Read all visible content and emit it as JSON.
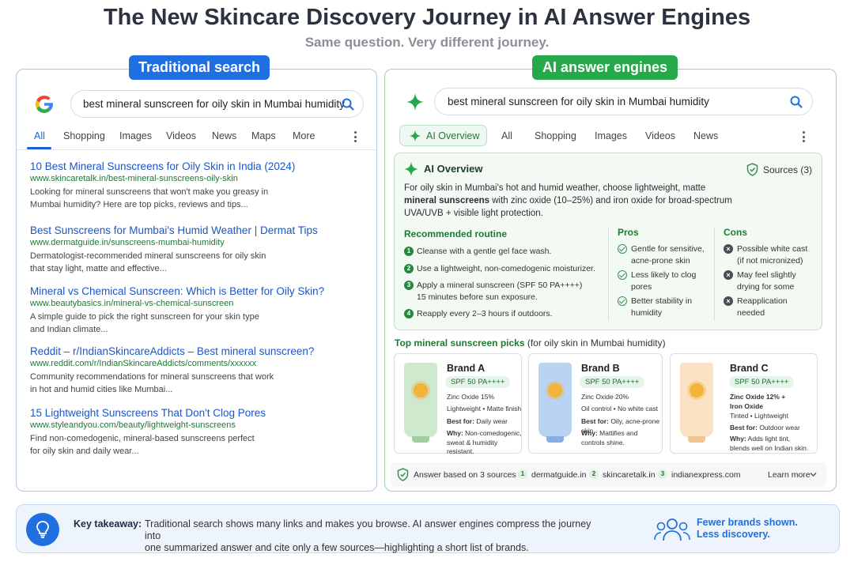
{
  "header": {
    "title": "The New Skincare Discovery Journey in AI Answer Engines",
    "subtitle": "Same question. Very different journey."
  },
  "traditional": {
    "label": "Traditional search",
    "query": "best mineral sunscreen for oily skin in Mumbai humidity",
    "tabs": [
      "All",
      "Shopping",
      "Images",
      "Videos",
      "News",
      "Maps",
      "More"
    ],
    "results": [
      {
        "title": "10 Best Mineral Sunscreens for Oily Skin in India (2024)",
        "url": "www.skincaretalk.in/best-mineral-sunscreens-oily-skin",
        "desc1": "Looking for mineral sunscreens that won't make you greasy in",
        "desc2": "Mumbai humidity? Here are top picks, reviews and tips..."
      },
      {
        "title": "Best Sunscreens for Mumbai's Humid Weather | Dermat Tips",
        "url": "www.dermatguide.in/sunscreens-mumbai-humidity",
        "desc1": "Dermatologist-recommended mineral sunscreens for oily skin",
        "desc2": "that stay light, matte and effective..."
      },
      {
        "title": "Mineral vs Chemical Sunscreen: Which is Better for Oily Skin?",
        "url": "www.beautybasics.in/mineral-vs-chemical-sunscreen",
        "desc1": "A simple guide to pick the right sunscreen for your skin type",
        "desc2": "and Indian climate..."
      },
      {
        "title": "Reddit – r/IndianSkincareAddicts – Best mineral sunscreen?",
        "url": "www.reddit.com/r/IndianSkincareAddicts/comments/xxxxxx",
        "desc1": "Community recommendations for mineral sunscreens that work",
        "desc2": "in hot and humid cities like Mumbai..."
      },
      {
        "title": "15 Lightweight Sunscreens That Don't Clog Pores",
        "url": "www.styleandyou.com/beauty/lightweight-sunscreens",
        "desc1": "Find non-comedogenic, mineral-based sunscreens perfect",
        "desc2": "for oily skin and daily wear..."
      }
    ]
  },
  "ai": {
    "label": "AI answer engines",
    "query": "best mineral sunscreen for oily skin in Mumbai humidity",
    "tabs": [
      "AI Overview",
      "All",
      "Shopping",
      "Images",
      "Videos",
      "News"
    ],
    "overview": {
      "heading": "AI Overview",
      "sources": "Sources (3)",
      "line1": "For oily skin in Mumbai's hot and humid weather, choose lightweight, matte",
      "line2_bold": "mineral sunscreens",
      "line2_rest": " with zinc oxide (10–25%) and iron oxide for broad-spectrum",
      "line3": "UVA/UVB + visible light protection."
    },
    "routine": {
      "heading": "Recommended routine",
      "steps": [
        {
          "n": "1",
          "a": "Cleanse with a gentle gel face wash.",
          "b": ""
        },
        {
          "n": "2",
          "a": "Use a lightweight, non-comedogenic moisturizer.",
          "b": ""
        },
        {
          "n": "3",
          "a": "Apply a mineral sunscreen (SPF 50 PA++++)",
          "b": "15 minutes before sun exposure."
        },
        {
          "n": "4",
          "a": "Reapply every 2–3 hours if outdoors.",
          "b": ""
        }
      ]
    },
    "pros": {
      "heading": "Pros",
      "items": [
        {
          "a": "Gentle for sensitive,",
          "b": "acne-prone skin"
        },
        {
          "a": "Less likely to clog",
          "b": "pores"
        },
        {
          "a": "Better stability in",
          "b": "humidity"
        }
      ]
    },
    "cons": {
      "heading": "Cons",
      "items": [
        {
          "a": "Possible white cast",
          "b": "(if not micronized)"
        },
        {
          "a": "May feel slightly",
          "b": "drying for some"
        },
        {
          "a": "Reapplication",
          "b": "needed"
        }
      ]
    },
    "picks": {
      "heading_bold": "Top mineral sunscreen picks",
      "heading_rest": " (for oily skin in Mumbai humidity)",
      "cards": [
        {
          "brand": "Brand A",
          "spf": "SPF 50 PA++++",
          "l1": "Zinc Oxide 15%",
          "l2": "Lightweight • Matte finish",
          "best_label": "Best for:",
          "best": " Daily wear",
          "why_label": "Why:",
          "why1": " Non-comedogenic,",
          "why2": "sweat & humidity resistant.",
          "tube_color": "#cfe9cf",
          "cap_color": "#9fcf9f"
        },
        {
          "brand": "Brand B",
          "spf": "SPF 50 PA++++",
          "l1": "Zinc Oxide 20%",
          "l2": "Oil control • No white cast",
          "best_label": "Best for:",
          "best": " Oily, acne-prone skin",
          "why_label": "Why:",
          "why1": " Mattifies and",
          "why2": "controls shine.",
          "tube_color": "#b9d3f2",
          "cap_color": "#86aee3"
        },
        {
          "brand": "Brand C",
          "spf": "SPF 50 PA++++",
          "l1": "Zinc Oxide 12% +",
          "l1b": "Iron Oxide",
          "l2": "Tinted • Lightweight",
          "best_label": "Best for:",
          "best": " Outdoor wear",
          "why_label": "Why:",
          "why1": " Adds light tint,",
          "why2": "blends well on Indian skin.",
          "tube_color": "#fbe2c4",
          "cap_color": "#f0c592"
        }
      ]
    },
    "sourcebar": {
      "label": "Answer based on 3 sources",
      "sources": [
        {
          "n": "1",
          "name": "dermatguide.in"
        },
        {
          "n": "2",
          "name": "skincaretalk.in"
        },
        {
          "n": "3",
          "name": "indianexpress.com"
        }
      ],
      "learn_more": "Learn more"
    }
  },
  "takeaway": {
    "label": "Key takeaway:",
    "line1": "Traditional search shows many links and makes you browse. AI answer engines compress the journey into",
    "line2": "one summarized answer and cite only a few sources—highlighting a short list of brands.",
    "right1": "Fewer brands shown.",
    "right2": "Less discovery."
  },
  "colors": {
    "google_blue": "#1f6fe0",
    "ai_green": "#27a84a",
    "link_blue": "#1a56c9",
    "url_green": "#1e7a34"
  }
}
